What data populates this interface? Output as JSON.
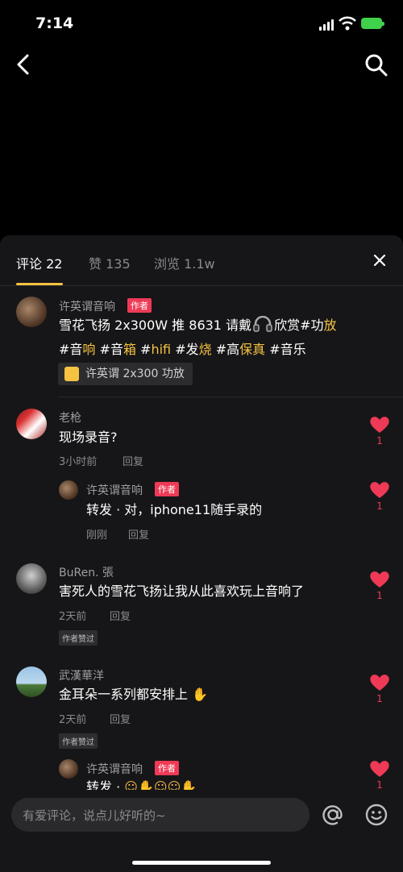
{
  "status": {
    "time": "7:14"
  },
  "tabs": [
    {
      "label": "评论 22",
      "active": true
    },
    {
      "label": "赞 135",
      "active": false
    },
    {
      "label": "浏览 1.1w",
      "active": false
    }
  ],
  "post": {
    "author": "许英谓音响",
    "author_tag": "作者",
    "line1_text": "雪花飞扬 2x300W 推 8631 请戴",
    "line1_text2": "欣赏#功",
    "line1_hl": "放",
    "line2": [
      {
        "t": "#音",
        "hl": false
      },
      {
        "t": "响",
        "hl": true
      },
      {
        "t": " #音",
        "hl": false
      },
      {
        "t": "箱",
        "hl": true
      },
      {
        "t": " #",
        "hl": false
      },
      {
        "t": "hifi",
        "hl": true
      },
      {
        "t": " #发",
        "hl": false
      },
      {
        "t": "烧",
        "hl": true
      },
      {
        "t": " #高",
        "hl": false
      },
      {
        "t": "保真",
        "hl": true
      },
      {
        "t": " #音乐",
        "hl": false
      }
    ],
    "product": "许英谓 2x300 功放"
  },
  "comments": [
    {
      "name": "老枪",
      "text": "现场录音?",
      "time": "3小时前",
      "reply": "回复",
      "likes": "1",
      "sub": {
        "name": "许英谓音响",
        "tag": "作者",
        "text": "转发 · 对，iphone11随手录的",
        "time": "刚刚",
        "reply": "回复",
        "likes": "1"
      }
    },
    {
      "name": "BuRen. 張",
      "text": "害死人的雪花飞扬让我从此喜欢玩上音响了",
      "time": "2天前",
      "reply": "回复",
      "badge": "作者赞过",
      "likes": "1"
    },
    {
      "name": "武漢華洋",
      "text": "金耳朵一系列都安排上",
      "time": "2天前",
      "reply": "回复",
      "badge": "作者赞过",
      "likes": "1",
      "sub": {
        "name": "许英谓音响",
        "tag": "作者",
        "text": "转发 ·",
        "likes": "1"
      }
    }
  ],
  "input": {
    "placeholder": "有爱评论，说点儿好听的~"
  },
  "colors": {
    "accent": "#f5c242",
    "like": "#ee3a56",
    "sheet": "#161618"
  }
}
